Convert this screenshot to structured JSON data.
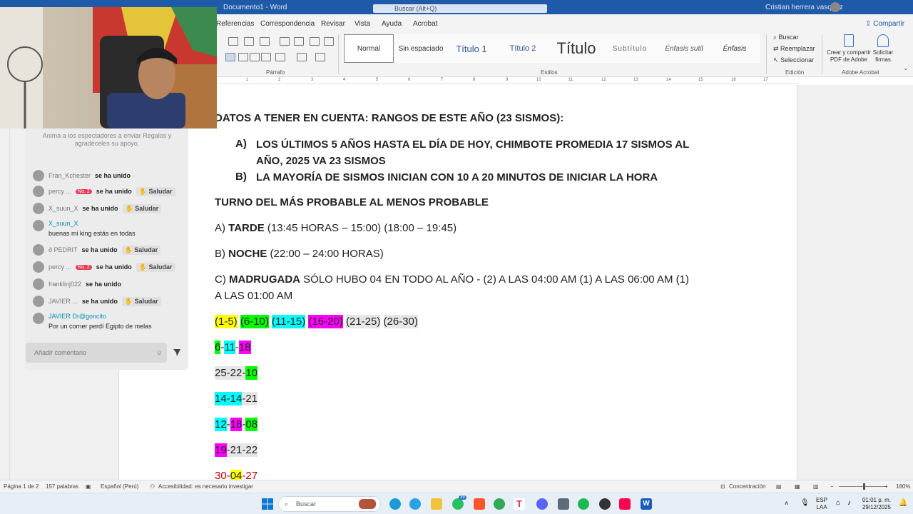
{
  "window": {
    "title": "Documento1 - Word",
    "search_placeholder": "Buscar (Alt+Q)",
    "user_name": "Cristian herrera vasquez"
  },
  "ribbon": {
    "tabs": [
      "Referencias",
      "Correspondencia",
      "Revisar",
      "Vista",
      "Ayuda",
      "Acrobat"
    ],
    "share_label": "Compartir",
    "paragraph_group": "Párrafo",
    "styles_group": "Estilos",
    "editing_group": "Edición",
    "adobe_group": "Adobe Acrobat",
    "styles": [
      "Normal",
      "Sin espaciado",
      "Título 1",
      "Título 2",
      "Título",
      "Subtítulo",
      "Énfasis sutil",
      "Énfasis"
    ],
    "editing": {
      "find": "Buscar",
      "replace": "Reemplazar",
      "select": "Seleccionar"
    },
    "adobe": {
      "create": "Crear y compartir PDF de Adobe",
      "request": "Solicitar firmas"
    }
  },
  "ruler": {
    "numbers": [
      "1",
      "2",
      "3",
      "4",
      "5",
      "6",
      "7",
      "8",
      "9",
      "10",
      "11",
      "12",
      "13",
      "14",
      "15",
      "16",
      "17"
    ]
  },
  "document": {
    "heading": "DATOS A TENER EN CUENTA: RANGOS DE ESTE AÑO (23 SISMOS):",
    "item_a_label": "A)",
    "item_a_text": "LOS ÚLTIMOS 5 AÑOS HASTA EL DÍA DE HOY, CHIMBOTE PROMEDIA 17 SISMOS AL AÑO, 2025 VA 23 SISMOS",
    "item_b_label": "B)",
    "item_b_text": "LA MAYORÍA DE SISMOS INICIAN CON 10 A 20 MINUTOS DE INICIAR LA HORA",
    "turno_heading": "TURNO DEL MÁS PROBABLE AL MENOS PROBABLE",
    "turno_a_prefix": "A)",
    "turno_a_bold": "TARDE",
    "turno_a_rest": "(13:45 HORAS – 15:00) (18:00 – 19:45)",
    "turno_b_prefix": "B)",
    "turno_b_bold": "NOCHE",
    "turno_b_rest": "(22:00 – 24:00 HORAS)",
    "turno_c_prefix": "C)",
    "turno_c_bold": "MADRUGADA",
    "turno_c_rest": "SÓLO HUBO 04 EN TODO AL AÑO - (2) A LAS 04:00 AM (1) A LAS 06:00 AM (1)",
    "turno_c_rest2": "A LAS 01:00 AM",
    "ranges": [
      "(1-5)",
      "(6-10)",
      "(11-15)",
      "(16-20)",
      "(21-25)",
      "(26-30)"
    ],
    "seq1": [
      "6",
      "-",
      "11",
      "-",
      "18"
    ],
    "seq2": [
      "25-22-",
      "10"
    ],
    "seq3": [
      "14-14",
      "-21"
    ],
    "seq4": [
      "12",
      "-",
      "18",
      "-",
      "08"
    ],
    "seq5": [
      "19",
      "-21-22"
    ],
    "seq6": [
      "30",
      "-",
      "04",
      "-27"
    ]
  },
  "chat": {
    "hint": "Anima a los espectadores a enviar Regalos y agradéceles su apoyo.",
    "joined_text": "se ha unido",
    "saludar": "Saludar",
    "badge_no2": "No. 2",
    "users": [
      "Fran_Kchester",
      "percy ...",
      "X_suun_X",
      "ð PEDRIT",
      "percy ...",
      "franklinj022",
      "JAVIER ...",
      "JAVIER"
    ],
    "msg1_name": "X_suun_X",
    "msg1_text": "buenas mi king estás en todas",
    "msg2_name": "Dr@goncito",
    "msg2_text": "Por un corner perdí Egipto de melas",
    "input_placeholder": "Añadir comentario"
  },
  "statusbar": {
    "page": "Página 1 de 2",
    "words": "157 palabras",
    "language": "Español (Perú)",
    "accessibility": "Accesibilidad: es necesario investigar",
    "focus": "Concentración",
    "zoom": "180%"
  },
  "taskbar": {
    "search": "Buscar",
    "badge_count": "39",
    "lang": "ESP",
    "lang2": "LAA",
    "time": "01:01 p. m.",
    "date": "29/12/2025"
  }
}
